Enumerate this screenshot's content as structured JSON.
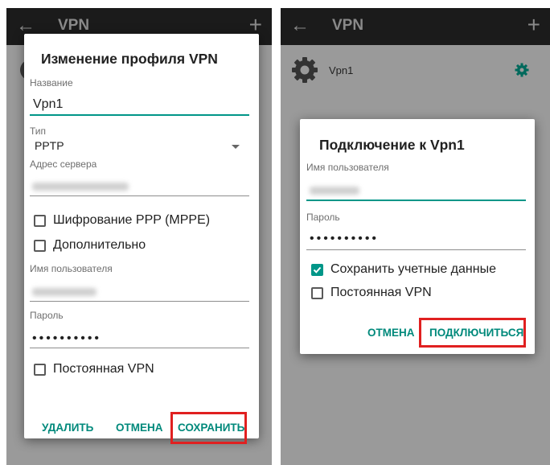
{
  "left": {
    "appbar": {
      "title": "VPN",
      "back_glyph": "←",
      "plus_glyph": "+"
    },
    "dialog": {
      "title": "Изменение профиля VPN",
      "name_label": "Название",
      "name_value": "Vpn1",
      "type_label": "Тип",
      "type_value": "PPTP",
      "server_label": "Адрес сервера",
      "encryption_label": "Шифрование PPP (MPPE)",
      "advanced_label": "Дополнительно",
      "username_label": "Имя пользователя",
      "password_label": "Пароль",
      "password_value": "••••••••••",
      "always_on_label": "Постоянная VPN",
      "delete_button": "УДАЛИТЬ",
      "cancel_button": "ОТМЕНА",
      "save_button": "СОХРАНИТЬ"
    }
  },
  "right": {
    "appbar": {
      "title": "VPN",
      "back_glyph": "←",
      "plus_glyph": "+"
    },
    "list": {
      "vpn_name": "Vpn1"
    },
    "dialog": {
      "title": "Подключение к Vpn1",
      "username_label": "Имя пользователя",
      "password_label": "Пароль",
      "password_value": "••••••••••",
      "save_credentials_label": "Сохранить учетные данные",
      "save_credentials_checked": true,
      "always_on_label": "Постоянная VPN",
      "cancel_button": "ОТМЕНА",
      "connect_button": "ПОДКЛЮЧИТЬСЯ"
    }
  },
  "colors": {
    "accent": "#009688",
    "highlight_box": "#e02020",
    "appbar": "#1b1b1b",
    "scrim": "#9a9a9a"
  }
}
